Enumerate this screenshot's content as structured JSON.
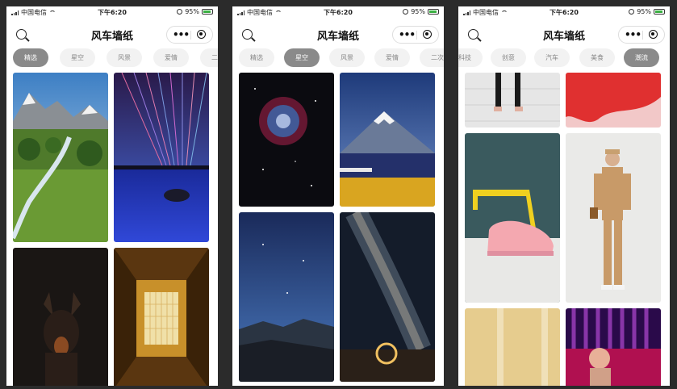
{
  "status": {
    "carrier": "中国电信",
    "time": "下午6:20",
    "battery": "95%"
  },
  "nav": {
    "title": "风车墙纸",
    "more": "•••"
  },
  "phones": [
    {
      "tabs": [
        "精选",
        "星空",
        "风景",
        "爱情",
        "二次"
      ],
      "active_tab": 0
    },
    {
      "tabs": [
        "精选",
        "星空",
        "风景",
        "爱情",
        "二次"
      ],
      "active_tab": 1
    },
    {
      "tabs": [
        "科技",
        "创意",
        "汽车",
        "美食",
        "潮流"
      ],
      "active_tab": 4
    }
  ]
}
